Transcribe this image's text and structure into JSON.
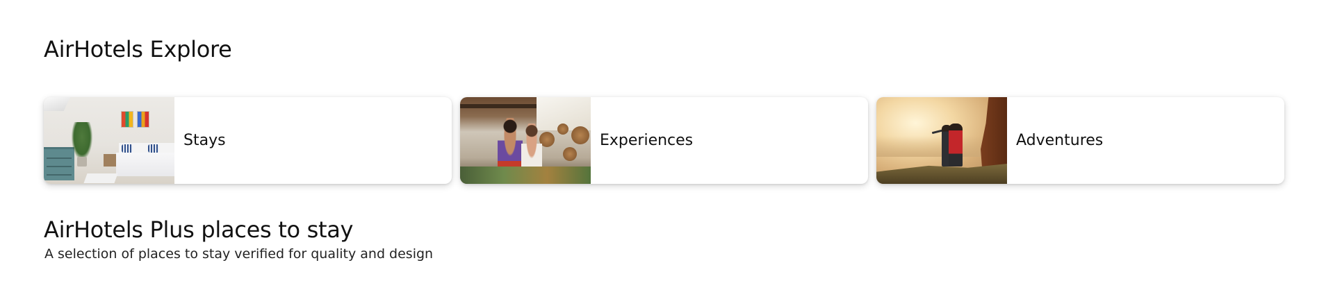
{
  "explore": {
    "title": "AirHotels Explore",
    "cards": [
      {
        "label": "Stays",
        "image_icon": "bedroom-photo"
      },
      {
        "label": "Experiences",
        "image_icon": "cooking-photo"
      },
      {
        "label": "Adventures",
        "image_icon": "hiking-photo"
      }
    ]
  },
  "plus": {
    "title": "AirHotels Plus places to stay",
    "subtitle": "A selection of places to stay verified for quality and design"
  },
  "colors": {
    "background": "#ffffff",
    "text_primary": "#111111",
    "card_shadow": "rgba(0,0,0,0.16)"
  }
}
